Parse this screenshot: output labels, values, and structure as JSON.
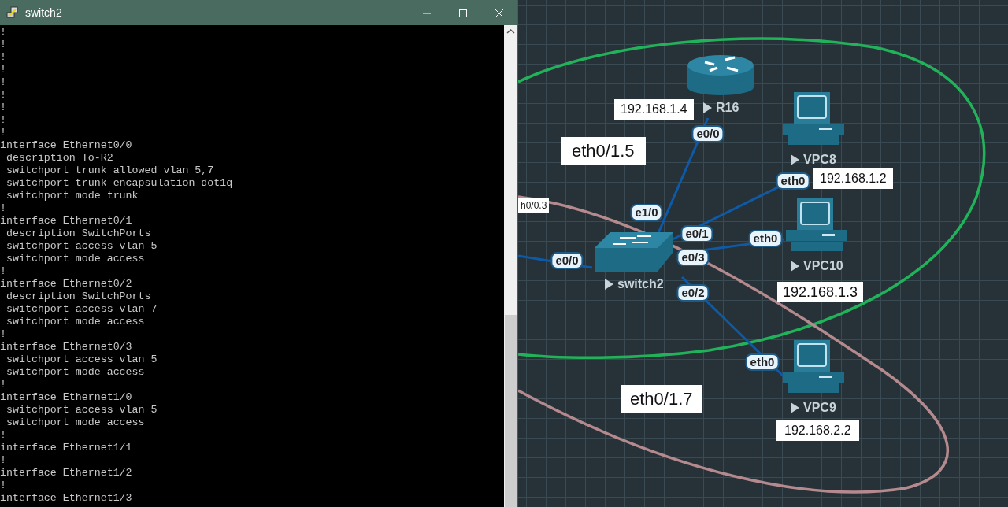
{
  "window": {
    "title": "switch2"
  },
  "terminal": {
    "lines": [
      "!",
      "!",
      "!",
      "!",
      "!",
      "!",
      "!",
      "!",
      "!",
      "interface Ethernet0/0",
      " description To-R2",
      " switchport trunk allowed vlan 5,7",
      " switchport trunk encapsulation dot1q",
      " switchport mode trunk",
      "!",
      "interface Ethernet0/1",
      " description SwitchPorts",
      " switchport access vlan 5",
      " switchport mode access",
      "!",
      "interface Ethernet0/2",
      " description SwitchPorts",
      " switchport access vlan 7",
      " switchport mode access",
      "!",
      "interface Ethernet0/3",
      " switchport access vlan 5",
      " switchport mode access",
      "!",
      "interface Ethernet1/0",
      " switchport access vlan 5",
      " switchport mode access",
      "!",
      "interface Ethernet1/1",
      "!",
      "interface Ethernet1/2",
      "!",
      "interface Ethernet1/3"
    ]
  },
  "topology": {
    "zones": [
      {
        "color": "#22b35a"
      },
      {
        "color": "#b58a8f"
      }
    ],
    "nodes": [
      {
        "kind": "router",
        "name": "R16"
      },
      {
        "kind": "pc",
        "name": "VPC8"
      },
      {
        "kind": "pc",
        "name": "VPC10"
      },
      {
        "kind": "switch",
        "name": "switch2"
      },
      {
        "kind": "pc",
        "name": "VPC9"
      }
    ],
    "port_labels": [
      "e0/0",
      "eth0",
      "e1/0",
      "e0/1",
      "eth0",
      "e0/0",
      "e0/3",
      "e0/2",
      "eth0"
    ],
    "notes": [
      "192.168.1.4",
      "eth0/1.5",
      "192.168.1.2",
      "h0/0.3",
      "192.168.1.3",
      "eth0/1.7",
      "192.168.2.2"
    ]
  }
}
